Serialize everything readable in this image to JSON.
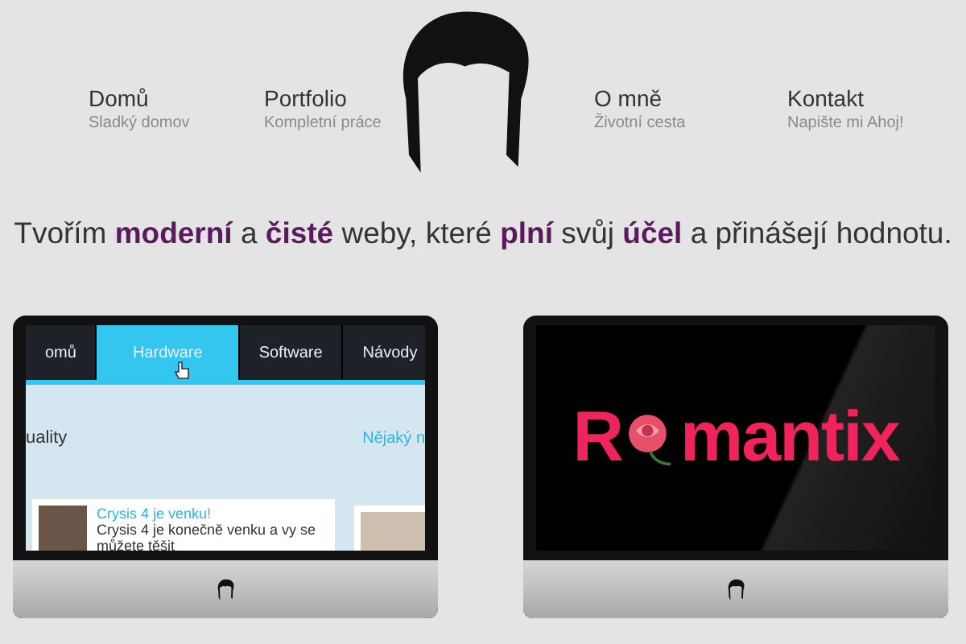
{
  "nav_left": [
    {
      "title": "Domů",
      "subtitle": "Sladký domov"
    },
    {
      "title": "Portfolio",
      "subtitle": "Kompletní práce"
    }
  ],
  "nav_right": [
    {
      "title": "O mně",
      "subtitle": "Životní cesta"
    },
    {
      "title": "Kontakt",
      "subtitle": "Napište mi Ahoj!"
    }
  ],
  "tagline": "Tvořím **moderní** a **čisté** weby, které **plní** svůj **účel** a přinášejí hodnotu.",
  "showcase": [
    {
      "kind": "tech-site",
      "tabs": [
        {
          "label": "omů",
          "selected": false
        },
        {
          "label": "Hardware",
          "selected": true
        },
        {
          "label": "Software",
          "selected": false
        },
        {
          "label": "Návody",
          "selected": false
        }
      ],
      "heading": "uality",
      "link": "Nějaký n",
      "article_title": "Crysis 4 je venku!",
      "article_text": "Crysis 4 je konečně venku a vy se můžete těšit"
    },
    {
      "kind": "brand-site",
      "brand_start": "R",
      "brand_end": "mantix"
    }
  ]
}
